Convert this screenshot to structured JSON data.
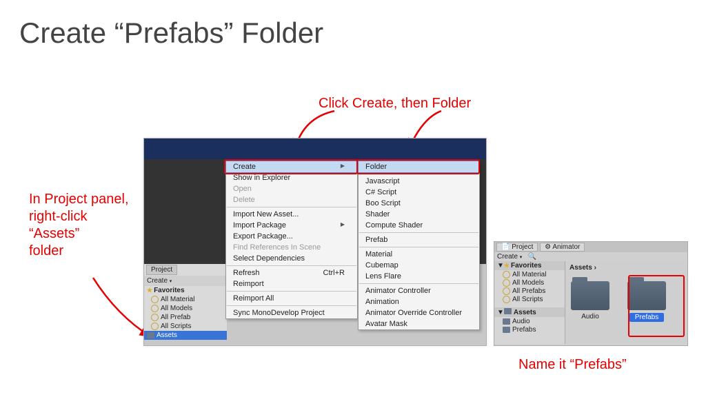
{
  "title": "Create “Prefabs” Folder",
  "annotations": {
    "top": "Click Create, then Folder",
    "left": "In Project panel,\nright-click\n“Assets”\nfolder",
    "bottom_right": "Name it “Prefabs”"
  },
  "project_panel": {
    "tab": "Project",
    "create_btn": "Create",
    "favorites_header": "Favorites",
    "favorites": [
      "All Material",
      "All Models",
      "All Prefab",
      "All Scripts"
    ],
    "assets": "Assets"
  },
  "context_menu_1": {
    "create": "Create",
    "items_top": [
      "Show in Explorer",
      "Open",
      "Delete"
    ],
    "items_mid": [
      "Import New Asset...",
      "Import Package",
      "Export Package...",
      "Find References In Scene",
      "Select Dependencies"
    ],
    "refresh": "Refresh",
    "refresh_key": "Ctrl+R",
    "reimport": "Reimport",
    "reimport_all": "Reimport All",
    "sync": "Sync MonoDevelop Project"
  },
  "context_menu_2": {
    "folder": "Folder",
    "group_scripts": [
      "Javascript",
      "C# Script",
      "Boo Script",
      "Shader",
      "Compute Shader"
    ],
    "prefab": "Prefab",
    "group_assets": [
      "Material",
      "Cubemap",
      "Lens Flare"
    ],
    "group_anim": [
      "Animator Controller",
      "Animation",
      "Animator Override Controller",
      "Avatar Mask"
    ]
  },
  "result_panel": {
    "tab_project": "Project",
    "tab_animator": "Animator",
    "create_btn": "Create",
    "favorites_header": "Favorites",
    "favorites": [
      "All Material",
      "All Models",
      "All Prefabs",
      "All Scripts"
    ],
    "assets_header": "Assets",
    "assets_children": [
      "Audio",
      "Prefabs"
    ],
    "breadcrumb": "Assets ›",
    "folder_audio": "Audio",
    "folder_prefabs": "Prefabs"
  }
}
